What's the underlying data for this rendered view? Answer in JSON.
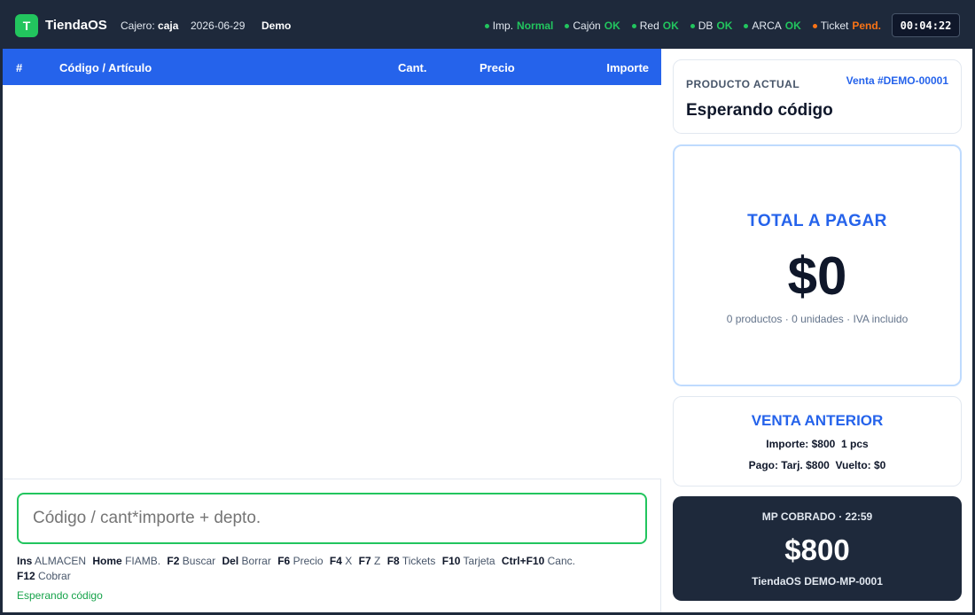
{
  "header": {
    "logo_letter": "T",
    "app_name": "TiendaOS",
    "cashier_label": "Cajero:",
    "cashier_name": "caja",
    "date": "2026-06-29",
    "mode": "Demo",
    "statuses": [
      {
        "label": "Imp.",
        "value": "Normal",
        "state": "ok"
      },
      {
        "label": "Cajón",
        "value": "OK",
        "state": "ok"
      },
      {
        "label": "Red",
        "value": "OK",
        "state": "ok"
      },
      {
        "label": "DB",
        "value": "OK",
        "state": "ok"
      },
      {
        "label": "ARCA",
        "value": "OK",
        "state": "ok"
      },
      {
        "label": "Ticket",
        "value": "Pend.",
        "state": "warn"
      }
    ],
    "clock": "00:04:22"
  },
  "table": {
    "columns": [
      "#",
      "Código / Artículo",
      "Cant.",
      "Precio",
      "Importe"
    ],
    "rows": []
  },
  "entry": {
    "placeholder": "Código / cant*importe + depto."
  },
  "shortcuts": [
    {
      "key": "Ins",
      "label": "ALMACEN"
    },
    {
      "key": "Home",
      "label": "FIAMB."
    },
    {
      "key": "F2",
      "label": "Buscar"
    },
    {
      "key": "Del",
      "label": "Borrar"
    },
    {
      "key": "F6",
      "label": "Precio"
    },
    {
      "key": "F4",
      "label": "X"
    },
    {
      "key": "F7",
      "label": "Z"
    },
    {
      "key": "F8",
      "label": "Tickets"
    },
    {
      "key": "F10",
      "label": "Tarjeta"
    },
    {
      "key": "Ctrl+F10",
      "label": "Canc."
    },
    {
      "key": "F12",
      "label": "Cobrar"
    }
  ],
  "status_line": "Esperando código",
  "product": {
    "label": "PRODUCTO ACTUAL",
    "sale_id": "Venta #DEMO-00001",
    "current": "Esperando código"
  },
  "total": {
    "label": "TOTAL A PAGAR",
    "amount": "$0",
    "summary": "0 productos · 0 unidades · IVA incluido"
  },
  "previous_sale": {
    "label": "VENTA ANTERIOR",
    "line1": "Importe: $800  1 pcs",
    "line2": "Pago: Tarj. $800  Vuelto: $0"
  },
  "mp": {
    "label": "MP COBRADO · 22:59",
    "amount": "$800",
    "ref": "TiendaOS DEMO-MP-0001"
  },
  "colors": {
    "accent": "#2563eb",
    "ok": "#22c55e",
    "warn": "#f97316",
    "dark": "#1e293b"
  }
}
